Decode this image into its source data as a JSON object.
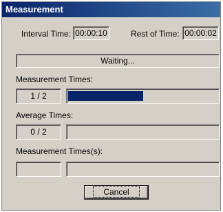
{
  "window": {
    "title": "Measurement"
  },
  "interval": {
    "label": "Interval Time:",
    "value": "00:00:10"
  },
  "rest": {
    "label": "Rest of Time:",
    "value": "00:00:02"
  },
  "status": {
    "text": "Waiting..."
  },
  "measurement": {
    "label": "Measurement Times:",
    "count": "1 / 2",
    "progress_fraction": 0.5
  },
  "average": {
    "label": "Average Times:",
    "count": "0 / 2",
    "progress_fraction": 0
  },
  "measurement_s": {
    "label": "Measurement Times(s):",
    "count": "",
    "progress_fraction": 0
  },
  "buttons": {
    "cancel": "Cancel"
  },
  "colors": {
    "title_bar": "#0a246a",
    "progress_fill": "#0a246a",
    "face": "#d4d0c8"
  }
}
